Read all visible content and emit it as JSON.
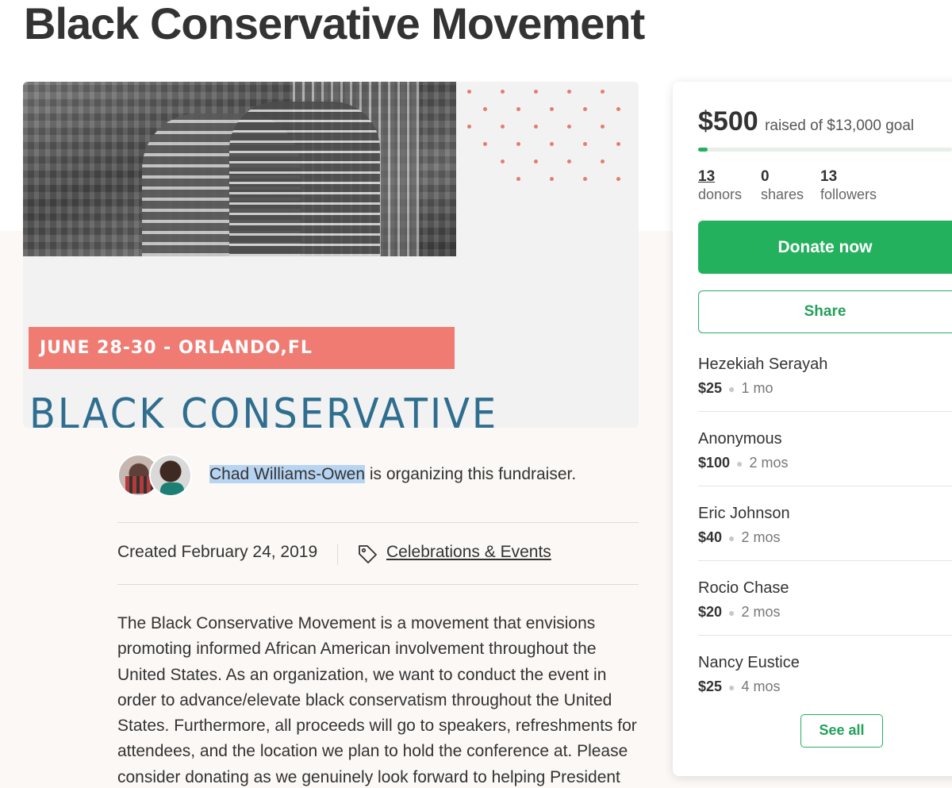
{
  "page": {
    "title": "Black Conservative Movement"
  },
  "hero": {
    "date_banner": "JUNE 28-30 - ORLANDO,FL",
    "headline": "BLACK CONSERVATIVE"
  },
  "organizer": {
    "name": "Chad Williams-Owen",
    "suffix": " is organizing this fundraiser."
  },
  "meta": {
    "created": "Created February 24, 2019",
    "category": "Celebrations & Events"
  },
  "story": "The Black Conservative Movement is a movement that envisions promoting informed African American involvement throughout the United States. As an organization, we want to conduct the event in order to advance/elevate black conservatism throughout the United States. Furthermore, all proceeds will go to speakers, refreshments for attendees, and the location we plan to hold the conference at. Please consider donating as we genuinely look forward to helping President",
  "sidebar": {
    "raised_amount": "$500",
    "raised_goal_text": "raised of $13,000 goal",
    "progress_fraction": 0.0385,
    "stats": [
      {
        "value": "13",
        "label": "donors"
      },
      {
        "value": "0",
        "label": "shares"
      },
      {
        "value": "13",
        "label": "followers"
      }
    ],
    "donate_label": "Donate now",
    "share_label": "Share",
    "donations": [
      {
        "name": "Hezekiah Serayah",
        "amount": "$25",
        "time": "1 mo"
      },
      {
        "name": "Anonymous",
        "amount": "$100",
        "time": "2 mos"
      },
      {
        "name": "Eric Johnson",
        "amount": "$40",
        "time": "2 mos"
      },
      {
        "name": "Rocio Chase",
        "amount": "$20",
        "time": "2 mos"
      },
      {
        "name": "Nancy Eustice",
        "amount": "$25",
        "time": "4 mos"
      }
    ],
    "see_all_label": "See all"
  },
  "colors": {
    "brand_green": "#24b15e",
    "banner_red": "#ef7b73",
    "headline_blue": "#2f6e8f",
    "selection_blue": "#b7d5f2"
  },
  "icons": {
    "category": "tag-icon"
  }
}
